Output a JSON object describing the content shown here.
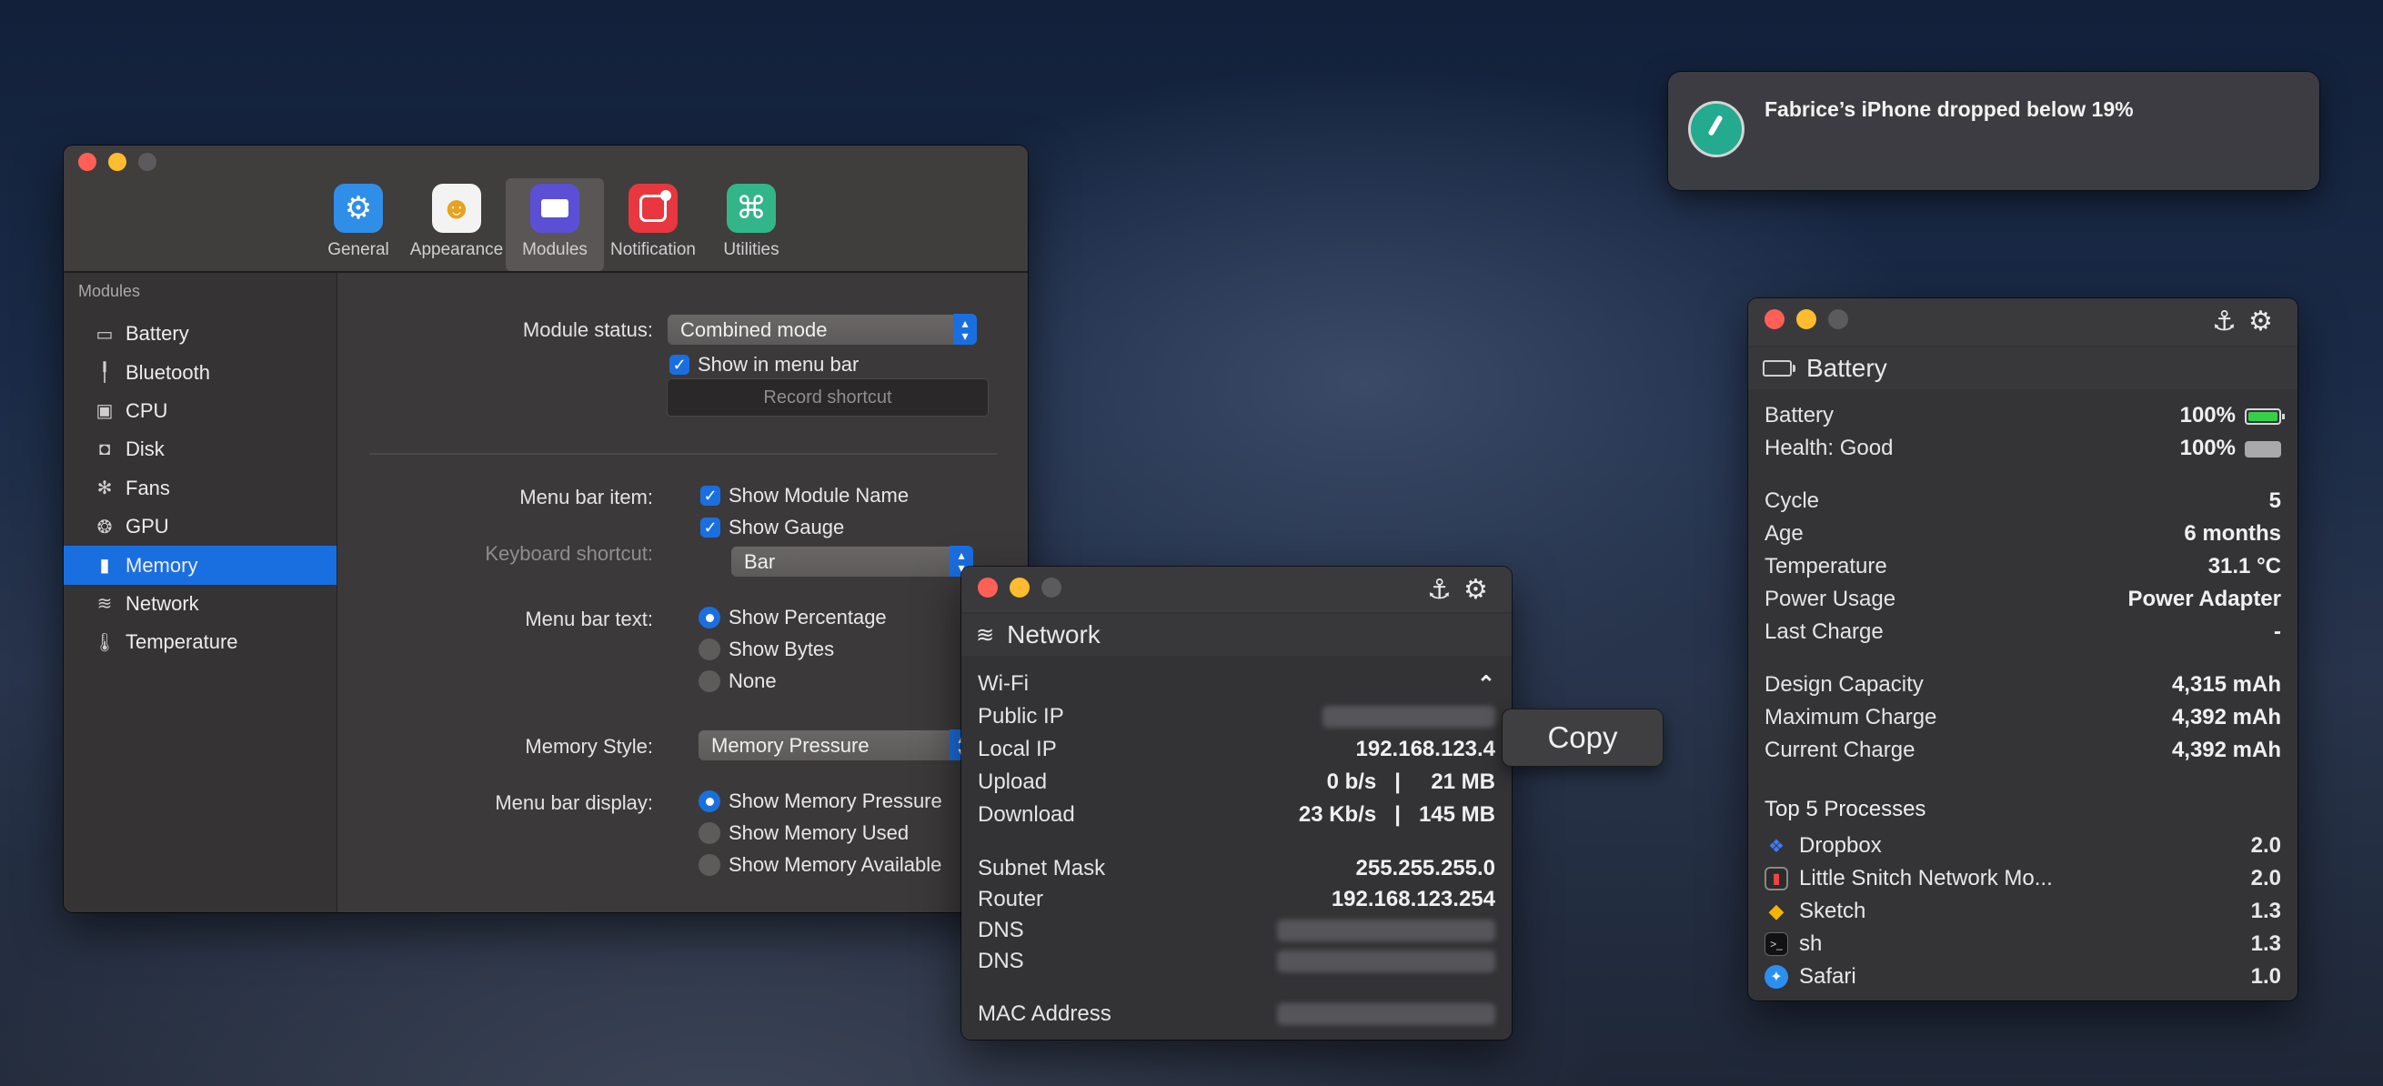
{
  "notification": {
    "message": "Fabrice’s iPhone dropped below 19%"
  },
  "prefs": {
    "toolbar": [
      {
        "label": "General",
        "icon": "gear-icon",
        "color": "#2f8ee8"
      },
      {
        "label": "Appearance",
        "icon": "theater-masks-icon",
        "color": "#f0f0f0"
      },
      {
        "label": "Modules",
        "icon": "modules-icon",
        "color": "#5b4fd6"
      },
      {
        "label": "Notification",
        "icon": "notification-icon",
        "color": "#e8373e"
      },
      {
        "label": "Utilities",
        "icon": "command-icon",
        "color": "#33b58a"
      }
    ],
    "sidebar_heading": "Modules",
    "sidebar": [
      {
        "label": "Battery",
        "icon": "battery-icon"
      },
      {
        "label": "Bluetooth",
        "icon": "airpods-icon"
      },
      {
        "label": "CPU",
        "icon": "cpu-icon"
      },
      {
        "label": "Disk",
        "icon": "disk-icon"
      },
      {
        "label": "Fans",
        "icon": "fan-icon"
      },
      {
        "label": "GPU",
        "icon": "gpu-icon"
      },
      {
        "label": "Memory",
        "icon": "memory-icon",
        "selected": true
      },
      {
        "label": "Network",
        "icon": "wifi-icon"
      },
      {
        "label": "Temperature",
        "icon": "thermometer-icon"
      }
    ],
    "module_status_label": "Module status:",
    "module_status_value": "Combined mode",
    "show_in_menu_bar": "Show in menu bar",
    "keyboard_shortcut_label": "Keyboard shortcut:",
    "record_shortcut": "Record shortcut",
    "menu_bar_item_label": "Menu bar item:",
    "show_module_name": "Show Module Name",
    "show_gauge": "Show Gauge",
    "gauge_style": "Bar",
    "menu_bar_text_label": "Menu bar text:",
    "menu_bar_text_options": [
      "Show Percentage",
      "Show Bytes",
      "None"
    ],
    "memory_style_label": "Memory Style:",
    "memory_style_value": "Memory Pressure",
    "menu_bar_display_label": "Menu bar display:",
    "menu_bar_display_options": [
      "Show Memory Pressure",
      "Show Memory Used",
      "Show Memory Available"
    ]
  },
  "network": {
    "title": "Network",
    "rows": [
      {
        "k": "Wi-Fi",
        "v": ""
      },
      {
        "k": "Public IP",
        "v": ""
      },
      {
        "k": "Local IP",
        "v": "192.168.123.4"
      },
      {
        "k": "Upload",
        "v": "0 b/s   |     21 MB"
      },
      {
        "k": "Download",
        "v": "23 Kb/s   |   145 MB"
      },
      {
        "k": "Subnet Mask",
        "v": "255.255.255.0"
      },
      {
        "k": "Router",
        "v": "192.168.123.254"
      },
      {
        "k": "DNS",
        "v": ""
      },
      {
        "k": "DNS",
        "v": ""
      },
      {
        "k": "MAC Address",
        "v": ""
      }
    ],
    "copy_label": "Copy"
  },
  "battery": {
    "title": "Battery",
    "rows": [
      {
        "k": "Battery",
        "v": "100%"
      },
      {
        "k": "Health: Good",
        "v": "100%"
      },
      {
        "k": "Cycle",
        "v": "5"
      },
      {
        "k": "Age",
        "v": "6 months"
      },
      {
        "k": "Temperature",
        "v": "31.1 °C"
      },
      {
        "k": "Power Usage",
        "v": "Power Adapter"
      },
      {
        "k": "Last Charge",
        "v": "-"
      },
      {
        "k": "Design Capacity",
        "v": "4,315 mAh"
      },
      {
        "k": "Maximum Charge",
        "v": "4,392 mAh"
      },
      {
        "k": "Current Charge",
        "v": "4,392 mAh"
      }
    ],
    "processes_title": "Top 5 Processes",
    "processes": [
      {
        "name": "Dropbox",
        "value": "2.0",
        "icon": "dropbox-icon"
      },
      {
        "name": "Little Snitch Network Mo...",
        "value": "2.0",
        "icon": "little-snitch-icon"
      },
      {
        "name": "Sketch",
        "value": "1.3",
        "icon": "sketch-icon"
      },
      {
        "name": "sh",
        "value": "1.3",
        "icon": "terminal-icon"
      },
      {
        "name": "Safari",
        "value": "1.0",
        "icon": "safari-icon"
      }
    ]
  }
}
